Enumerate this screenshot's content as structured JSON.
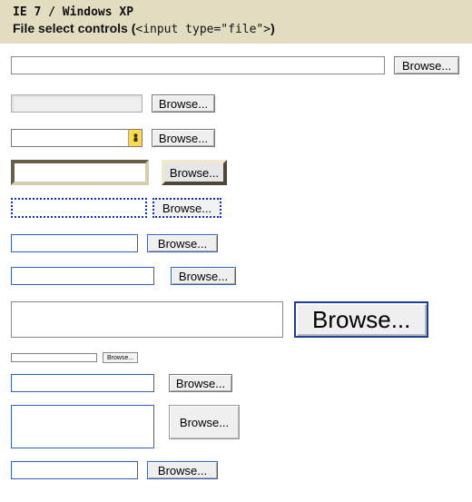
{
  "header": {
    "line1": "IE 7 / Windows XP",
    "line2_pre": "File select controls (",
    "line2_code": "<input type=\"file\">",
    "line2_post": ")"
  },
  "rows": {
    "r1": {
      "value": "",
      "button": "Browse..."
    },
    "r2": {
      "value": "",
      "button": "Browse...",
      "disabled": true
    },
    "r3": {
      "value": "",
      "button": "Browse...",
      "warning_icon": "warning-icon"
    },
    "r4": {
      "value": "",
      "button": "Browse..."
    },
    "r5": {
      "value": "",
      "button": "Browse..."
    },
    "r6": {
      "value": "",
      "button": "Browse..."
    },
    "r7": {
      "value": "",
      "button": "Browse..."
    },
    "r8": {
      "value": "",
      "button": "Browse..."
    },
    "r9": {
      "value": "",
      "button": "Browse..."
    },
    "r10": {
      "value": "",
      "button": "Browse..."
    },
    "r11": {
      "value": "",
      "button": "Browse..."
    },
    "r12": {
      "value": "",
      "button": "Browse..."
    }
  }
}
